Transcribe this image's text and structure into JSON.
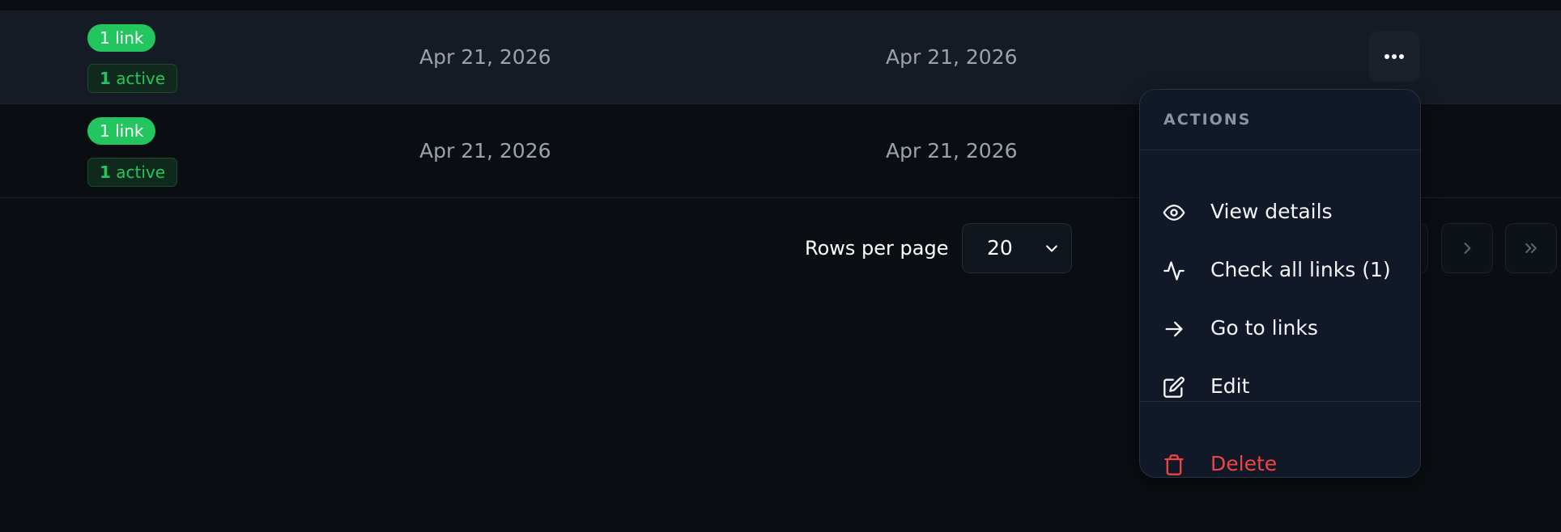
{
  "table": {
    "rows": [
      {
        "link_count_label": "1 link",
        "active_num": "1",
        "active_word": "active",
        "date_created": "Apr 21, 2026",
        "date_updated": "Apr 21, 2026"
      },
      {
        "link_count_label": "1 link",
        "active_num": "1",
        "active_word": "active",
        "date_created": "Apr 21, 2026",
        "date_updated": "Apr 21, 2026"
      }
    ],
    "more_button_icon": "more-horizontal-icon"
  },
  "pagination": {
    "rows_per_page_label": "Rows per page",
    "rows_per_page_value": "20"
  },
  "actions_menu": {
    "header": "ACTIONS",
    "items": [
      {
        "label": "View details",
        "icon": "eye-icon"
      },
      {
        "label": "Check all links (1)",
        "icon": "activity-icon"
      },
      {
        "label": "Go to links",
        "icon": "arrow-right-icon"
      },
      {
        "label": "Edit",
        "icon": "edit-icon"
      }
    ],
    "delete": {
      "label": "Delete",
      "icon": "trash-icon"
    }
  },
  "colors": {
    "background": "#0a0e12",
    "highlight_row": "#141b24",
    "badge_green": "#22c55e",
    "danger": "#ef4444",
    "menu_bg": "#111827"
  }
}
